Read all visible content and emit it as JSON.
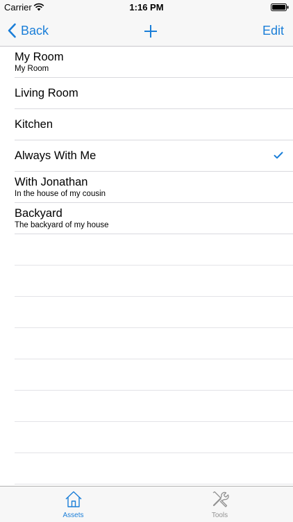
{
  "status_bar": {
    "carrier": "Carrier",
    "time": "1:16 PM"
  },
  "nav": {
    "back_label": "Back",
    "edit_label": "Edit"
  },
  "rooms": [
    {
      "title": "My Room",
      "subtitle": "My Room",
      "checked": false
    },
    {
      "title": "Living Room",
      "subtitle": "",
      "checked": false
    },
    {
      "title": "Kitchen",
      "subtitle": "",
      "checked": false
    },
    {
      "title": "Always With Me",
      "subtitle": "",
      "checked": true
    },
    {
      "title": "With Jonathan",
      "subtitle": "In the house of my cousin",
      "checked": false
    },
    {
      "title": "Backyard",
      "subtitle": "The backyard of my house",
      "checked": false
    }
  ],
  "tabs": [
    {
      "label": "Assets",
      "icon": "house-icon",
      "selected": true
    },
    {
      "label": "Tools",
      "icon": "tools-icon",
      "selected": false
    }
  ],
  "colors": {
    "accent": "#1a7ed8",
    "inactive": "#929292"
  }
}
